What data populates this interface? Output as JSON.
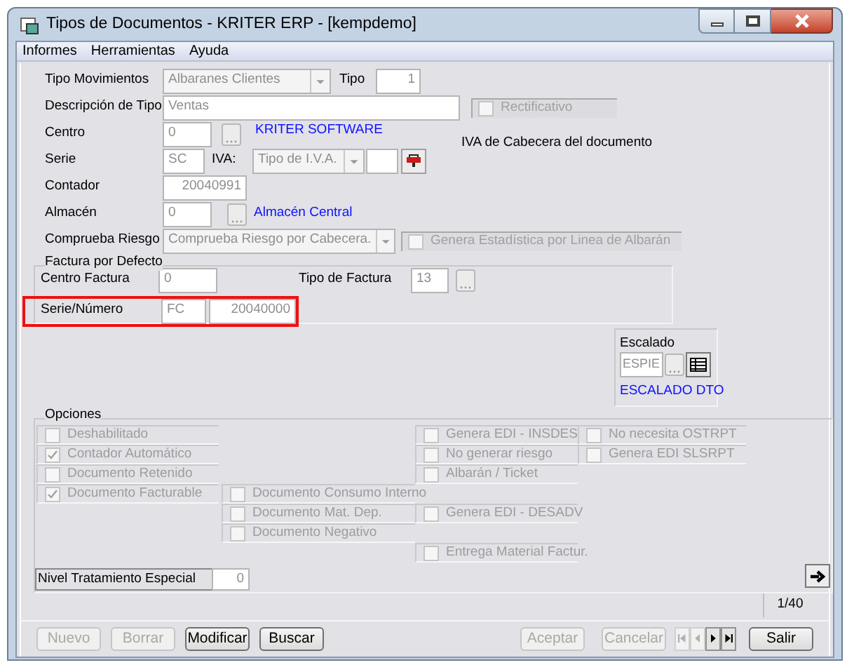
{
  "window": {
    "title": "Tipos de Documentos - KRITER ERP - [kempdemo]"
  },
  "menu": [
    "Informes",
    "Herramientas",
    "Ayuda"
  ],
  "form": {
    "tipo_movimientos": {
      "label": "Tipo Movimientos",
      "value": "Albaranes Clientes"
    },
    "tipo": {
      "label": "Tipo",
      "value": "1"
    },
    "descripcion": {
      "label": "Descripción de Tipo",
      "value": "Ventas"
    },
    "rectificativo": {
      "label": "Rectificativo",
      "checked": false
    },
    "centro": {
      "label": "Centro",
      "value": "0",
      "link": "KRITER SOFTWARE"
    },
    "iva_cabecera": {
      "label": "IVA de Cabecera del documento"
    },
    "serie": {
      "label": "Serie",
      "value": "SC"
    },
    "iva": {
      "label": "IVA:",
      "value": "Tipo de I.V.A."
    },
    "contador": {
      "label": "Contador",
      "value": "20040991"
    },
    "almacen": {
      "label": "Almacén",
      "value": "0",
      "link": "Almacén Central"
    },
    "comprueba_riesgo": {
      "label": "Comprueba Riesgo",
      "value": "Comprueba Riesgo por Cabecera."
    },
    "genera_estadistica": {
      "label": "Genera Estadística por Linea de Albarán",
      "checked": false
    }
  },
  "factura_por_defecto": {
    "title": "Factura por Defecto",
    "centro_factura": {
      "label": "Centro Factura",
      "value": "0"
    },
    "tipo_factura": {
      "label": "Tipo de Factura",
      "value": "13"
    },
    "serie_numero": {
      "label": "Serie/Número",
      "serie": "FC",
      "numero": "20040000"
    }
  },
  "escalado": {
    "title": "Escalado",
    "value": "ESPIE",
    "link": "ESCALADO DTO"
  },
  "opciones": {
    "title": "Opciones",
    "checkboxes": [
      {
        "label": "Deshabilitado",
        "checked": false
      },
      {
        "label": "Genera EDI - INSDES",
        "checked": false
      },
      {
        "label": "No necesita OSTRPT",
        "checked": false
      },
      {
        "label": "Contador Automático",
        "checked": true
      },
      {
        "label": "No generar riesgo",
        "checked": false
      },
      {
        "label": "Genera EDI SLSRPT",
        "checked": false
      },
      {
        "label": "Documento Retenido",
        "checked": false
      },
      {
        "label": "Albarán / Ticket",
        "checked": false
      },
      {
        "label": "Documento Facturable",
        "checked": true
      },
      {
        "label": "Documento Consumo Interno",
        "checked": false
      },
      {
        "label": "Documento Mat. Dep.",
        "checked": false
      },
      {
        "label": "Genera EDI - DESADV",
        "checked": false
      },
      {
        "label": "Documento Negativo",
        "checked": false
      },
      {
        "label": "Entrega Material Factur.",
        "checked": false
      }
    ],
    "nivel": {
      "label": "Nivel Tratamiento Especial",
      "value": "0"
    }
  },
  "record_counter": "1/40",
  "buttons": [
    {
      "label": "Nuevo",
      "disabled": true
    },
    {
      "label": "Borrar",
      "disabled": true
    },
    {
      "label": "Modificar",
      "disabled": false
    },
    {
      "label": "Buscar",
      "disabled": false
    }
  ],
  "right_buttons": [
    {
      "label": "Aceptar",
      "disabled": true
    },
    {
      "label": "Cancelar",
      "disabled": true
    }
  ],
  "nav": [
    {
      "kind": "first",
      "disabled": true
    },
    {
      "kind": "prev",
      "disabled": true
    },
    {
      "kind": "next",
      "disabled": false
    },
    {
      "kind": "last",
      "disabled": false
    }
  ],
  "exit_button": {
    "label": "Salir",
    "disabled": false
  }
}
